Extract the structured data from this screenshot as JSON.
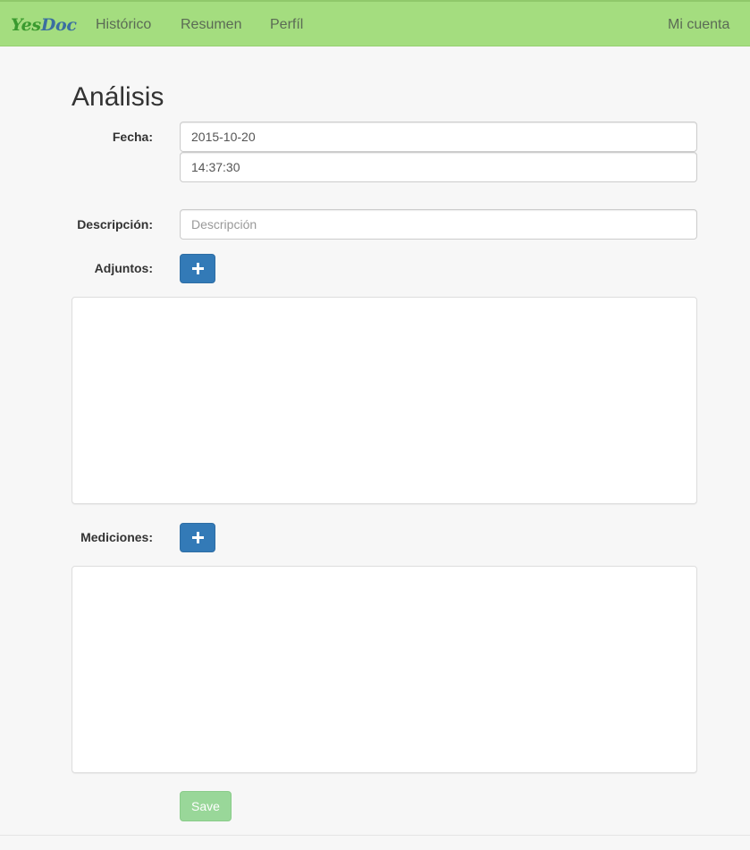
{
  "navbar": {
    "brand_yes": "Yes",
    "brand_doc": "Doc",
    "links": [
      "Histórico",
      "Resumen",
      "Perfíl"
    ],
    "account": "Mi cuenta",
    "background_color": "#a4dd7f"
  },
  "page": {
    "title": "Análisis"
  },
  "form": {
    "fecha_label": "Fecha:",
    "date_value": "2015-10-20",
    "time_value": "14:37:30",
    "descripcion_label": "Descripción:",
    "descripcion_placeholder": "Descripción",
    "descripcion_value": "",
    "adjuntos_label": "Adjuntos:",
    "mediciones_label": "Mediciones:",
    "add_icon": "plus-icon",
    "save_label": "Save",
    "primary_color": "#337ab7",
    "save_color": "#8fd48f"
  }
}
